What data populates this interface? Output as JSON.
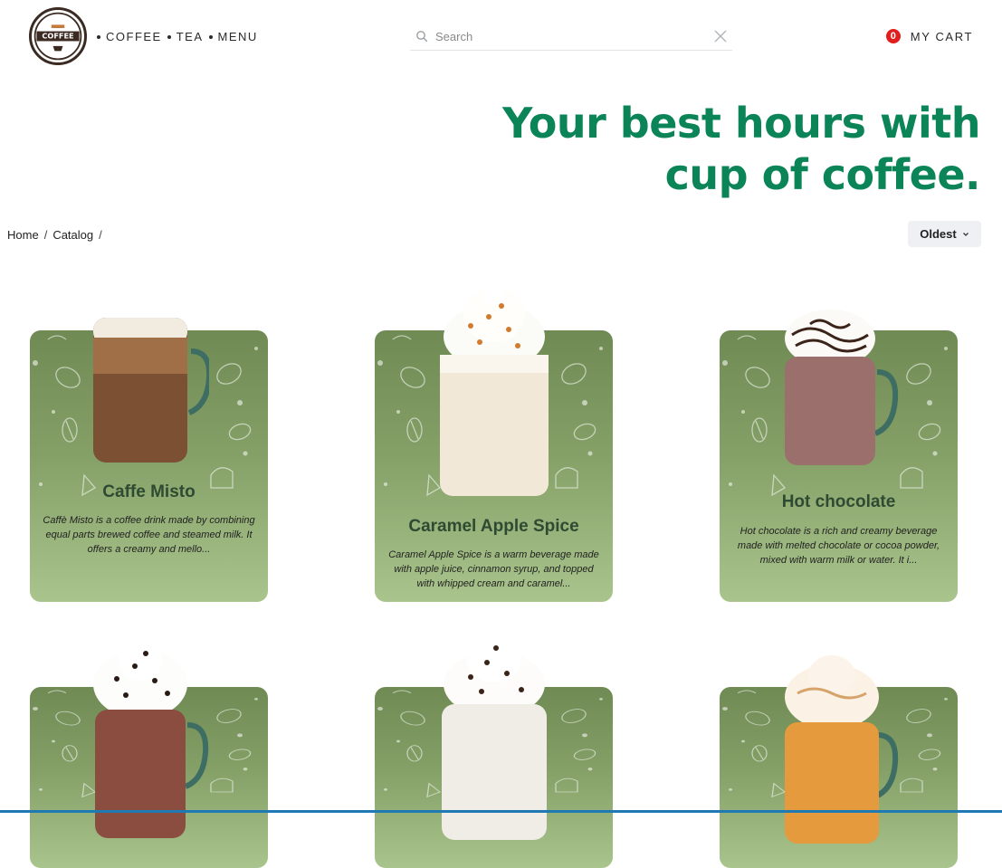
{
  "header": {
    "logo_text": "COFFEE",
    "nav": [
      {
        "label": "COFFEE"
      },
      {
        "label": "TEA"
      },
      {
        "label": "MENU"
      }
    ],
    "search": {
      "placeholder": "Search",
      "value": ""
    },
    "cart": {
      "count": "0",
      "label": "MY CART"
    }
  },
  "hero": {
    "line1": "Your best hours with",
    "line2": "cup of coffee."
  },
  "breadcrumb": [
    {
      "label": "Home"
    },
    {
      "label": "Catalog"
    }
  ],
  "sort": {
    "label": "Oldest"
  },
  "products": [
    {
      "name": "Caffe Misto",
      "desc": "Caffè Misto is a coffee drink made by combining equal parts brewed coffee and steamed milk. It offers a creamy and mello...",
      "drink": "latte-mug"
    },
    {
      "name": "Caramel Apple Spice",
      "desc": "Caramel Apple Spice is a warm beverage made with apple juice, cinnamon syrup, and topped with whipped cream and caramel...",
      "drink": "whipped-glass"
    },
    {
      "name": "Hot chocolate",
      "desc": "Hot chocolate is a rich and creamy beverage made with melted chocolate or cocoa powder, mixed with warm milk or water. It i...",
      "drink": "chocolate-mug"
    },
    {
      "name": "",
      "desc": "",
      "drink": "mocha-mug"
    },
    {
      "name": "",
      "desc": "",
      "drink": "white-cup"
    },
    {
      "name": "",
      "desc": "",
      "drink": "caramel-mug"
    }
  ],
  "colors": {
    "accent": "#0b8557",
    "badge": "#e01e1e",
    "card_top": "#6f8a53",
    "card_bottom": "#a9c48c"
  }
}
